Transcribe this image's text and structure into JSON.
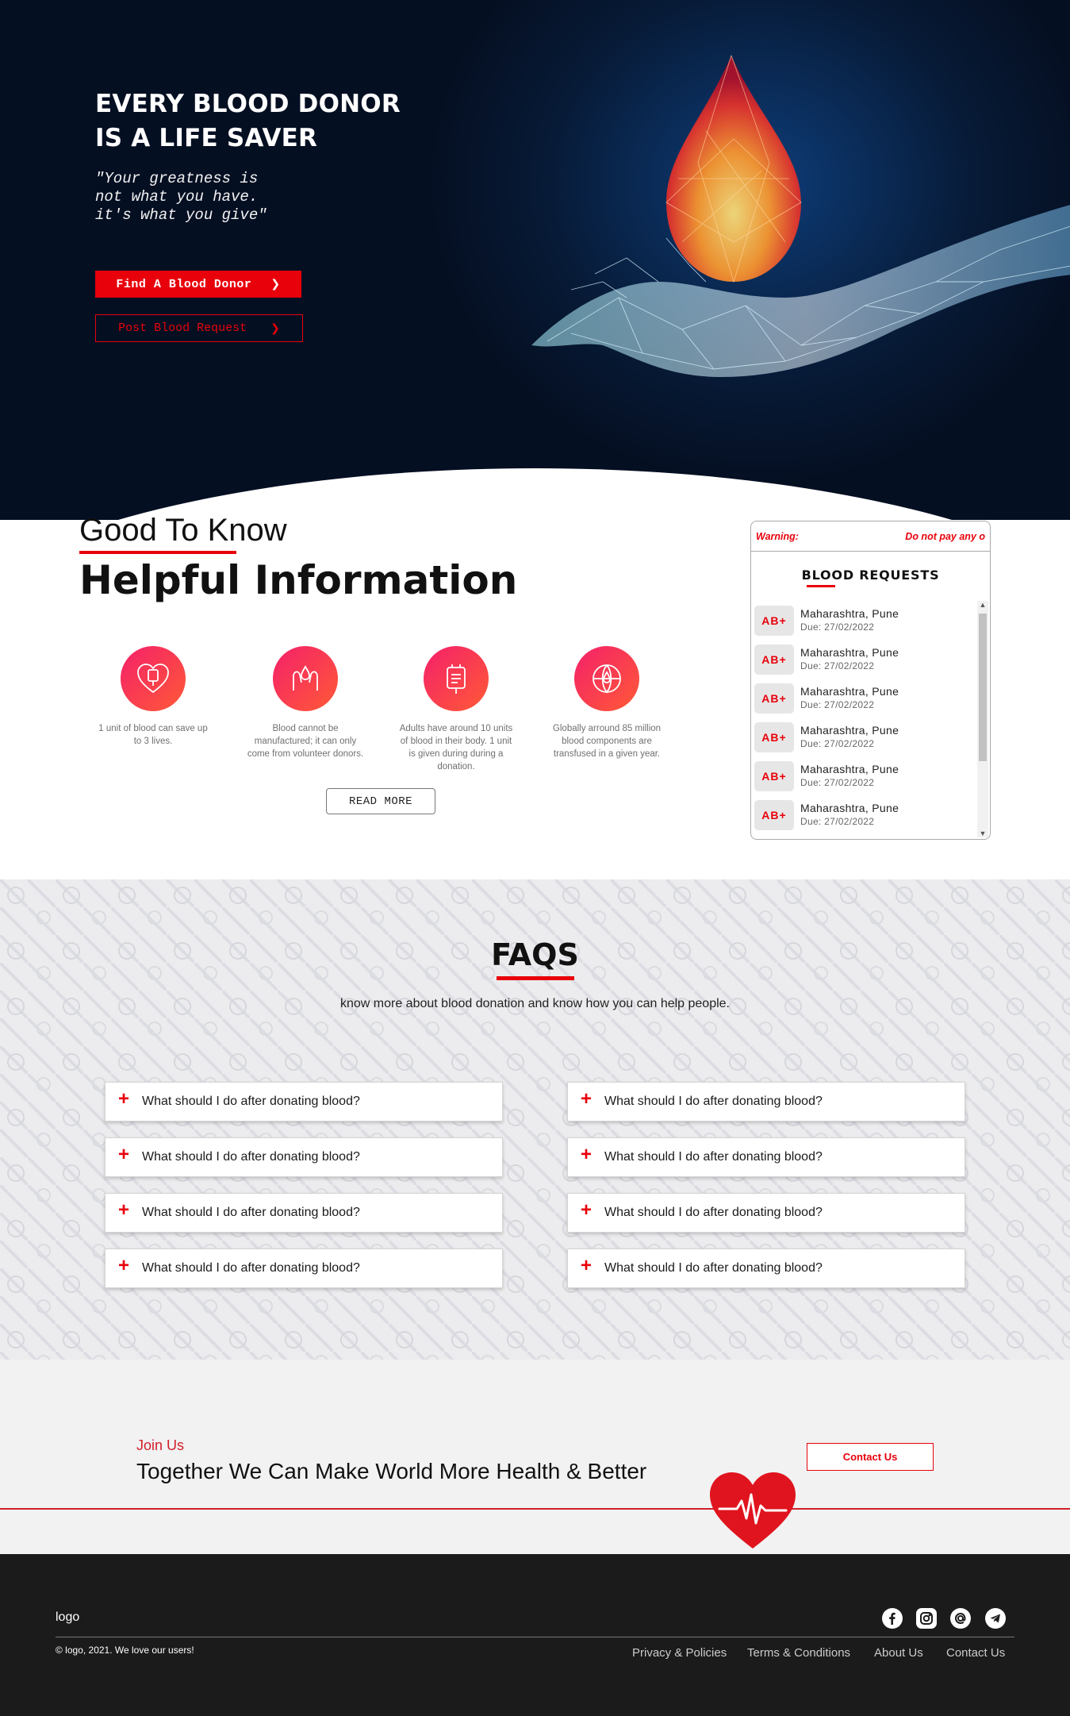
{
  "hero": {
    "title_line1": "EVERY BLOOD DONOR",
    "title_line2": "IS A LIFE SAVER",
    "quote_line1": "\"Your greatness is",
    "quote_line2": "not what you have.",
    "quote_line3": "it's what you give\"",
    "find_label": "Find A Blood Donor",
    "post_label": "Post Blood Request",
    "chevron": "❯"
  },
  "good_to_know": {
    "subtitle": "Good To Know",
    "title": "Helpful Information",
    "items": [
      {
        "icon": "heart-blood-bag-icon",
        "text": "1 unit of blood can save up to 3 lives."
      },
      {
        "icon": "hands-blood-icon",
        "text": "Blood cannot be manufactured; it can only come from volunteer donors."
      },
      {
        "icon": "blood-bag-icon",
        "text": "Adults have around 10 units of blood in their body. 1 unit is given during during a donation."
      },
      {
        "icon": "globe-drop-icon",
        "text": "Globally arround 85 million blood components are transfused in a given year."
      }
    ],
    "read_more": "READ MORE"
  },
  "requests": {
    "warning_label": "Warning:",
    "warning_text": "Do not pay any o",
    "title": "BLOOD REQUESTS",
    "items": [
      {
        "group": "AB+",
        "location": "Maharashtra, Pune",
        "due": "Due: 27/02/2022"
      },
      {
        "group": "AB+",
        "location": "Maharashtra, Pune",
        "due": "Due: 27/02/2022"
      },
      {
        "group": "AB+",
        "location": "Maharashtra, Pune",
        "due": "Due: 27/02/2022"
      },
      {
        "group": "AB+",
        "location": "Maharashtra, Pune",
        "due": "Due: 27/02/2022"
      },
      {
        "group": "AB+",
        "location": "Maharashtra, Pune",
        "due": "Due: 27/02/2022"
      },
      {
        "group": "AB+",
        "location": "Maharashtra, Pune",
        "due": "Due: 27/02/2022"
      }
    ]
  },
  "faq": {
    "title": "FAQS",
    "subtitle": "know more about blood donation and know how you can help people.",
    "plus": "+",
    "items": [
      "What should I do after donating blood?",
      "What should I do after donating blood?",
      "What should I do after donating blood?",
      "What should I do after donating blood?",
      "What should I do after donating blood?",
      "What should I do after donating blood?",
      "What should I do after donating blood?",
      "What should I do after donating blood?"
    ]
  },
  "join": {
    "small": "Join Us",
    "big": "Together We Can Make World More Health & Better",
    "contact_label": "Contact Us"
  },
  "footer": {
    "logo": "logo",
    "copyright": "© logo, 2021. We love our users!",
    "social": [
      "facebook-icon",
      "instagram-icon",
      "email-at-icon",
      "telegram-icon"
    ],
    "links": [
      "Privacy & Policies",
      "Terms & Conditions",
      "About Us",
      "Contact Us"
    ]
  },
  "colors": {
    "accent": "#e8000b",
    "hero_bg": "#071a36",
    "footer_bg": "#1b1b1b"
  }
}
